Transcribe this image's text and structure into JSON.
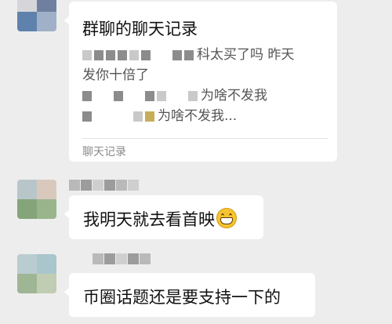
{
  "chat_record_card": {
    "title": "群聊的聊天记录",
    "lines": [
      {
        "visible_text": "科太买了吗 昨天"
      },
      {
        "visible_text": "发你十倍了"
      },
      {
        "visible_text": "为啥不发我"
      },
      {
        "visible_text": "为啥不发我..."
      }
    ],
    "footer_label": "聊天记录"
  },
  "messages": [
    {
      "text": "我明天就去看首映",
      "emoji_icon": "grinning-face-icon"
    },
    {
      "text": "币圈话题还是要支持一下的"
    }
  ],
  "colors": {
    "background": "#ededed",
    "bubble": "#ffffff",
    "footer_text": "#8a8a8a"
  }
}
